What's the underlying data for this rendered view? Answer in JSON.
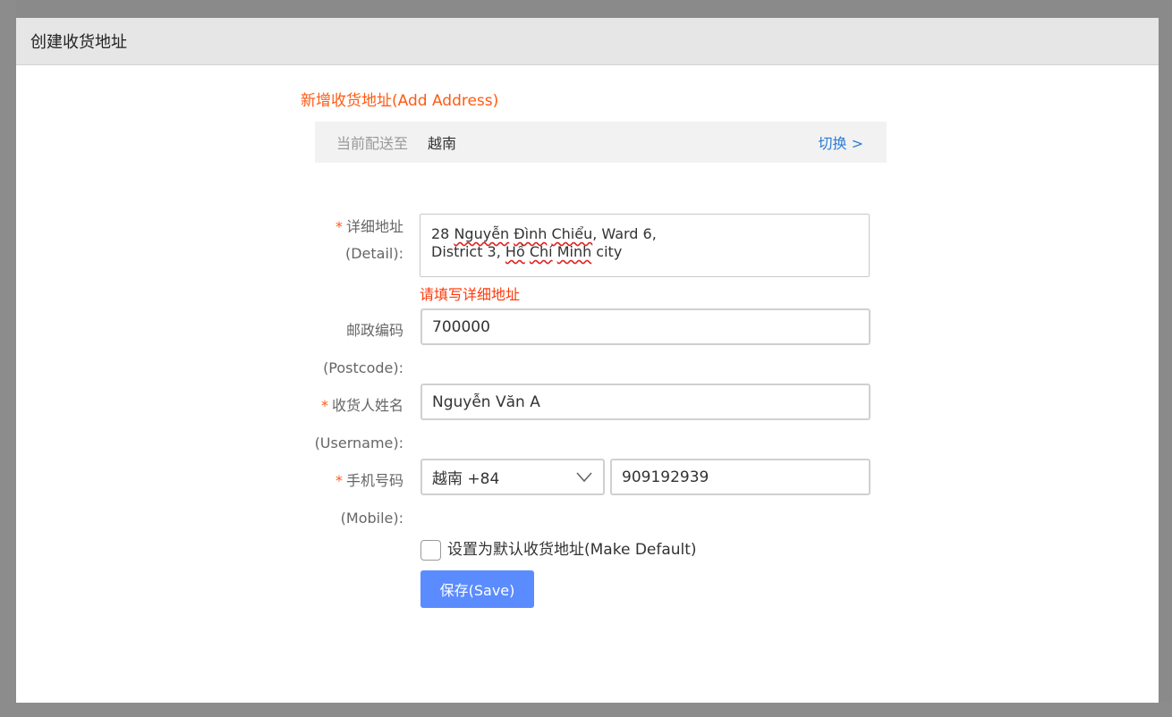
{
  "dialog": {
    "title": "创建收货地址"
  },
  "form": {
    "section_title": "新增收货地址(Add Address)",
    "shipping": {
      "label": "当前配送至",
      "country": "越南",
      "switch_label": "切换 >"
    },
    "required_mark": "*",
    "detail": {
      "label": "详细地址",
      "label_en": "(Detail):",
      "value_line1_parts": [
        "28 ",
        "Nguyễn",
        " ",
        "Đình",
        " ",
        "Chiểu",
        ", Ward 6,"
      ],
      "value_line2_parts": [
        "District 3, ",
        "Hồ",
        " ",
        "Chí",
        " ",
        "Minh",
        " city"
      ],
      "error": "请填写详细地址"
    },
    "postcode": {
      "label": "邮政编码",
      "label_en": "(Postcode):",
      "value": "700000"
    },
    "username": {
      "label": "收货人姓名",
      "label_en": "(Username):",
      "value": "Nguyễn Văn A"
    },
    "mobile": {
      "label": "手机号码",
      "label_en": "(Mobile):",
      "country_code": "越南 +84",
      "value": "909192939"
    },
    "make_default": {
      "label": "设置为默认收货地址(Make Default)",
      "checked": false
    },
    "save_label": "保存(Save)"
  },
  "colors": {
    "accent_orange": "#ff5a12",
    "link_blue": "#2d7bd6",
    "button_blue": "#5a8cff",
    "error_red": "#ff3a0a"
  },
  "icons": {
    "select": "chevron-down-icon"
  }
}
